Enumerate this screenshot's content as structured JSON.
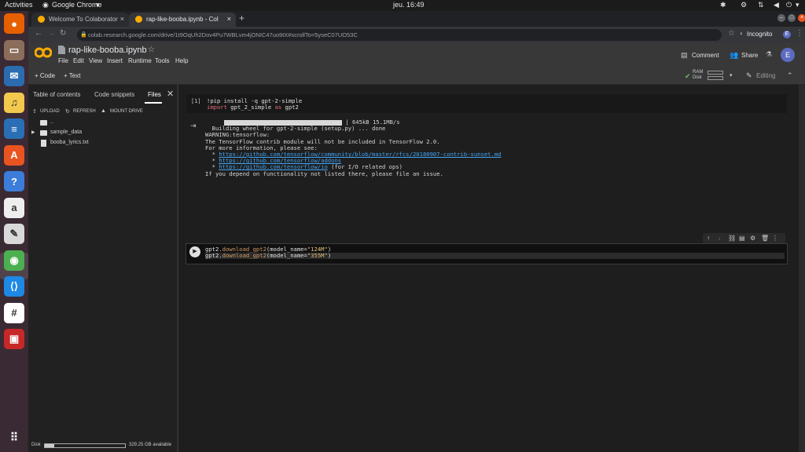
{
  "os": {
    "activities": "Activities",
    "app_menu": "Google Chrome",
    "clock": "jeu. 16:49",
    "dock": [
      {
        "icon": "firefox-icon",
        "color": "#e66000"
      },
      {
        "icon": "files-icon",
        "color": "#8a6d5a"
      },
      {
        "icon": "thunderbird-icon",
        "color": "#2b6cb0"
      },
      {
        "icon": "rhythmbox-icon",
        "color": "#f2c94c"
      },
      {
        "icon": "libreoffice-writer-icon",
        "color": "#2a6fb5"
      },
      {
        "icon": "software-center-icon",
        "color": "#e95420"
      },
      {
        "icon": "help-icon",
        "color": "#3b7dd8"
      },
      {
        "icon": "amazon-icon",
        "color": "#eeeeee"
      },
      {
        "icon": "text-editor-icon",
        "color": "#d9d9d9"
      },
      {
        "icon": "chrome-icon",
        "color": "#4caf50"
      },
      {
        "icon": "vscode-icon",
        "color": "#1e88e5"
      },
      {
        "icon": "slack-icon",
        "color": "#ffffff"
      },
      {
        "icon": "screenshot-icon",
        "color": "#c62828"
      }
    ],
    "apps_grid_icon": "show-applications-icon"
  },
  "browser": {
    "tabs": [
      {
        "label": "Welcome To Colaborator",
        "close": "×"
      },
      {
        "label": "rap-like-booba.ipynb - Col",
        "close": "×"
      }
    ],
    "new_tab": "+",
    "url": "colab.research.google.com/drive/1t9OqUh2Dov4Pu7WBLvm4jONIC47uo9tX#scrollTo=5yseC07UO53C",
    "profile": "Incognito",
    "avatar_letter": "E"
  },
  "colab": {
    "logo": "CO",
    "notebook_title": "rap-like-booba.ipynb",
    "menu": [
      "File",
      "Edit",
      "View",
      "Insert",
      "Runtime",
      "Tools",
      "Help"
    ],
    "comment_label": "Comment",
    "share_label": "Share",
    "avatar_letter": "E",
    "add_code": "+ Code",
    "add_text": "+ Text",
    "ram_label": "RAM",
    "disk_label": "Disk",
    "editing_label": "Editing",
    "sidebar": {
      "tabs": [
        "Table of contents",
        "Code snippets",
        "Files"
      ],
      "actions": [
        "UPLOAD",
        "REFRESH",
        "MOUNT DRIVE"
      ],
      "files": [
        {
          "name": "..",
          "type": "folder"
        },
        {
          "name": "sample_data",
          "type": "folder"
        },
        {
          "name": "booba_lyrics.txt",
          "type": "file"
        }
      ],
      "disk_label": "Disk",
      "disk_available": "329.25 GB available",
      "disk_usage": 0.12
    },
    "cell1": {
      "prompt": "[1]",
      "line1": [
        "!pip install -q gpt-2-simple"
      ],
      "line2_kw": "import",
      "line2_rest": "gpt_2_simple",
      "line2_as": "as",
      "line2_alias": "gpt2"
    },
    "output1": {
      "progress_text": "| 645kB 15.1MB/s",
      "lines": [
        "  Building wheel for gpt-2-simple (setup.py) ... done",
        "WARNING:tensorflow:",
        "The TensorFlow contrib module will not be included in TensorFlow 2.0.",
        "For more information, please see:"
      ],
      "links": [
        "https://github.com/tensorflow/community/blob/master/rfcs/20180907-contrib-sunset.md",
        "https://github.com/tensorflow/addons",
        "https://github.com/tensorflow/io"
      ],
      "io_suffix": " (for I/O related ops)",
      "last_line": "If you depend on functionality not listed there, please file an issue."
    },
    "cell2": {
      "line1": {
        "obj": "gpt2",
        "fn": "download_gpt2",
        "arg": "model_name=",
        "str": "\"124M\"",
        "close": ")"
      },
      "line2": {
        "obj": "gpt2",
        "fn": "download_gpt2",
        "arg": "model_name=",
        "str": "\"355M\"",
        "close": ")"
      }
    }
  }
}
